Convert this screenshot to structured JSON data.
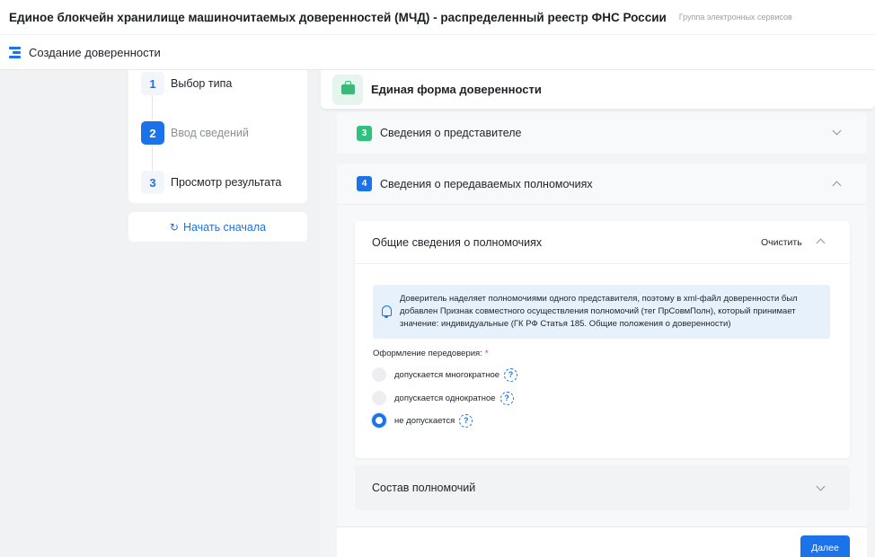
{
  "header": {
    "title": "Единое блокчейн хранилище машиночитаемых доверенностей (МЧД) - распределенный реестр ФНС России",
    "subtitle": "Группа электронных сервисов"
  },
  "subheader": {
    "icon": "list-icon",
    "title": "Создание доверенности"
  },
  "steps": [
    {
      "num": "1",
      "label": "Выбор типа",
      "state": "done"
    },
    {
      "num": "2",
      "label": "Ввод сведений",
      "state": "active"
    },
    {
      "num": "3",
      "label": "Просмотр результата",
      "state": "pending"
    }
  ],
  "restart": {
    "icon": "refresh-icon",
    "label": "Начать сначала"
  },
  "form": {
    "icon": "briefcase-icon",
    "title": "Единая форма доверенности"
  },
  "sections": [
    {
      "num": "3",
      "label": "Сведения о представителе",
      "badge_color": "#2ec27e",
      "expanded": false
    },
    {
      "num": "4",
      "label": "Сведения о передаваемых полномочиях",
      "badge_color": "#1a73e8",
      "expanded": true
    }
  ],
  "powers_card": {
    "title": "Общие сведения о полномочиях",
    "clear_label": "Очистить",
    "info_icon": "bell-icon",
    "info_text": "Доверитель наделяет полномочиями одного представителя, поэтому в xml-файл доверенности был добавлен Признак совместного осуществления полномочий (тег ПрСовмПолн), который принимает значение: индивидуальные (ГК РФ Статья 185. Общие положения о доверенности)",
    "field_label": "Оформление передоверия:",
    "required_mark": "*",
    "options": [
      {
        "label": "допускается многократное",
        "selected": false,
        "help": "?"
      },
      {
        "label": "допускается однократное",
        "selected": false,
        "help": "?"
      },
      {
        "label": "не допускается",
        "selected": true,
        "help": "?"
      }
    ]
  },
  "composition_card": {
    "title": "Состав полномочий"
  },
  "footer": {
    "next_label": "Далее"
  },
  "colors": {
    "accent": "#1a73e8",
    "success": "#2ec27e",
    "info_bg": "#e6f1fc"
  }
}
